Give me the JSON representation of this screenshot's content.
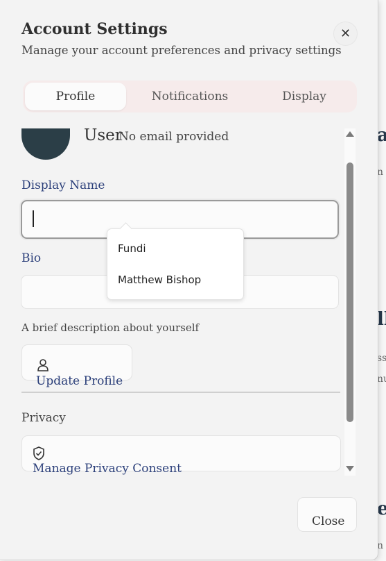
{
  "dialog": {
    "title": "Account Settings",
    "subtitle": "Manage your account preferences and privacy settings",
    "close_icon": "close-icon"
  },
  "tabs": [
    {
      "label": "Profile",
      "active": true
    },
    {
      "label": "Notifications",
      "active": false
    },
    {
      "label": "Display",
      "active": false
    }
  ],
  "profile": {
    "user_name": "User",
    "email": "No email provided",
    "display_name_label": "Display Name",
    "display_name_value": "",
    "bio_label": "Bio",
    "bio_value": "",
    "bio_hint": "A brief description about yourself",
    "update_button": "Update Profile",
    "update_icon": "user-icon"
  },
  "privacy": {
    "label": "Privacy",
    "manage_button": "Manage Privacy Consent",
    "icon": "shield-check-icon"
  },
  "suggestions": [
    "Fundi",
    "Matthew Bishop"
  ],
  "footer": {
    "close_button": "Close"
  },
  "colors": {
    "accent_text": "#2b3f7a",
    "avatar": "#2b3e47",
    "tab_bg": "#f6ebeb"
  }
}
